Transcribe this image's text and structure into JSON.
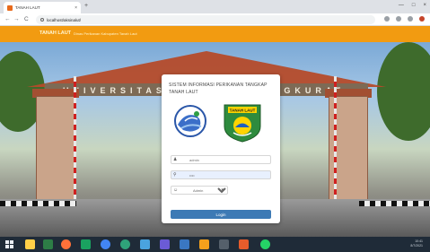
{
  "browser": {
    "tab_title": "TANAH LAUT",
    "tab_close": "×",
    "new_tab": "+",
    "window_controls": [
      "—",
      "□",
      "×"
    ],
    "nav": {
      "back": "←",
      "forward": "→",
      "reload": "C"
    },
    "url": "localhost/aksinalut/"
  },
  "site": {
    "brand": "TANAH LAUT",
    "topbar_link": "Dinas Perikanan Kabupaten Tanah Laut",
    "background_banner": "UNIVERSITAS LAMBUNG MANGKURAT"
  },
  "login": {
    "title": "SISTEM INFORMASI PERIKANAN TANGKAP TANAH LAUT",
    "username_placeholder": "admin",
    "username_icon": "user-icon",
    "password_value": "••••",
    "password_icon": "key-icon",
    "role_selected": "Admin",
    "role_icon": "role-icon",
    "button_label": "Login"
  },
  "colors": {
    "topbar": "#f29b11",
    "button": "#3d7ab5",
    "card": "#ffffff"
  },
  "taskbar": {
    "apps": [
      "file-explorer-icon",
      "store-icon",
      "firefox-icon",
      "media-icon",
      "chrome-icon",
      "edge-icon",
      "files-icon",
      "app-icon",
      "app-icon",
      "app-icon",
      "app-icon",
      "app-icon",
      "whatsapp-icon"
    ],
    "clock": "10:41",
    "date": "8/7/2021"
  }
}
